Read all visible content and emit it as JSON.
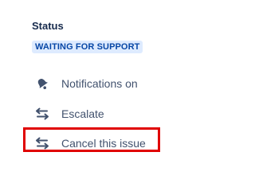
{
  "status": {
    "label": "Status",
    "badge": "WAITING FOR SUPPORT",
    "badge_bg": "#deebff",
    "badge_color": "#0747a6"
  },
  "actions": [
    {
      "label": "Notifications on",
      "icon": "bell-icon"
    },
    {
      "label": "Escalate",
      "icon": "swap-arrows-icon"
    },
    {
      "label": "Cancel this issue",
      "icon": "swap-arrows-icon"
    }
  ],
  "highlight_color": "#e00000"
}
